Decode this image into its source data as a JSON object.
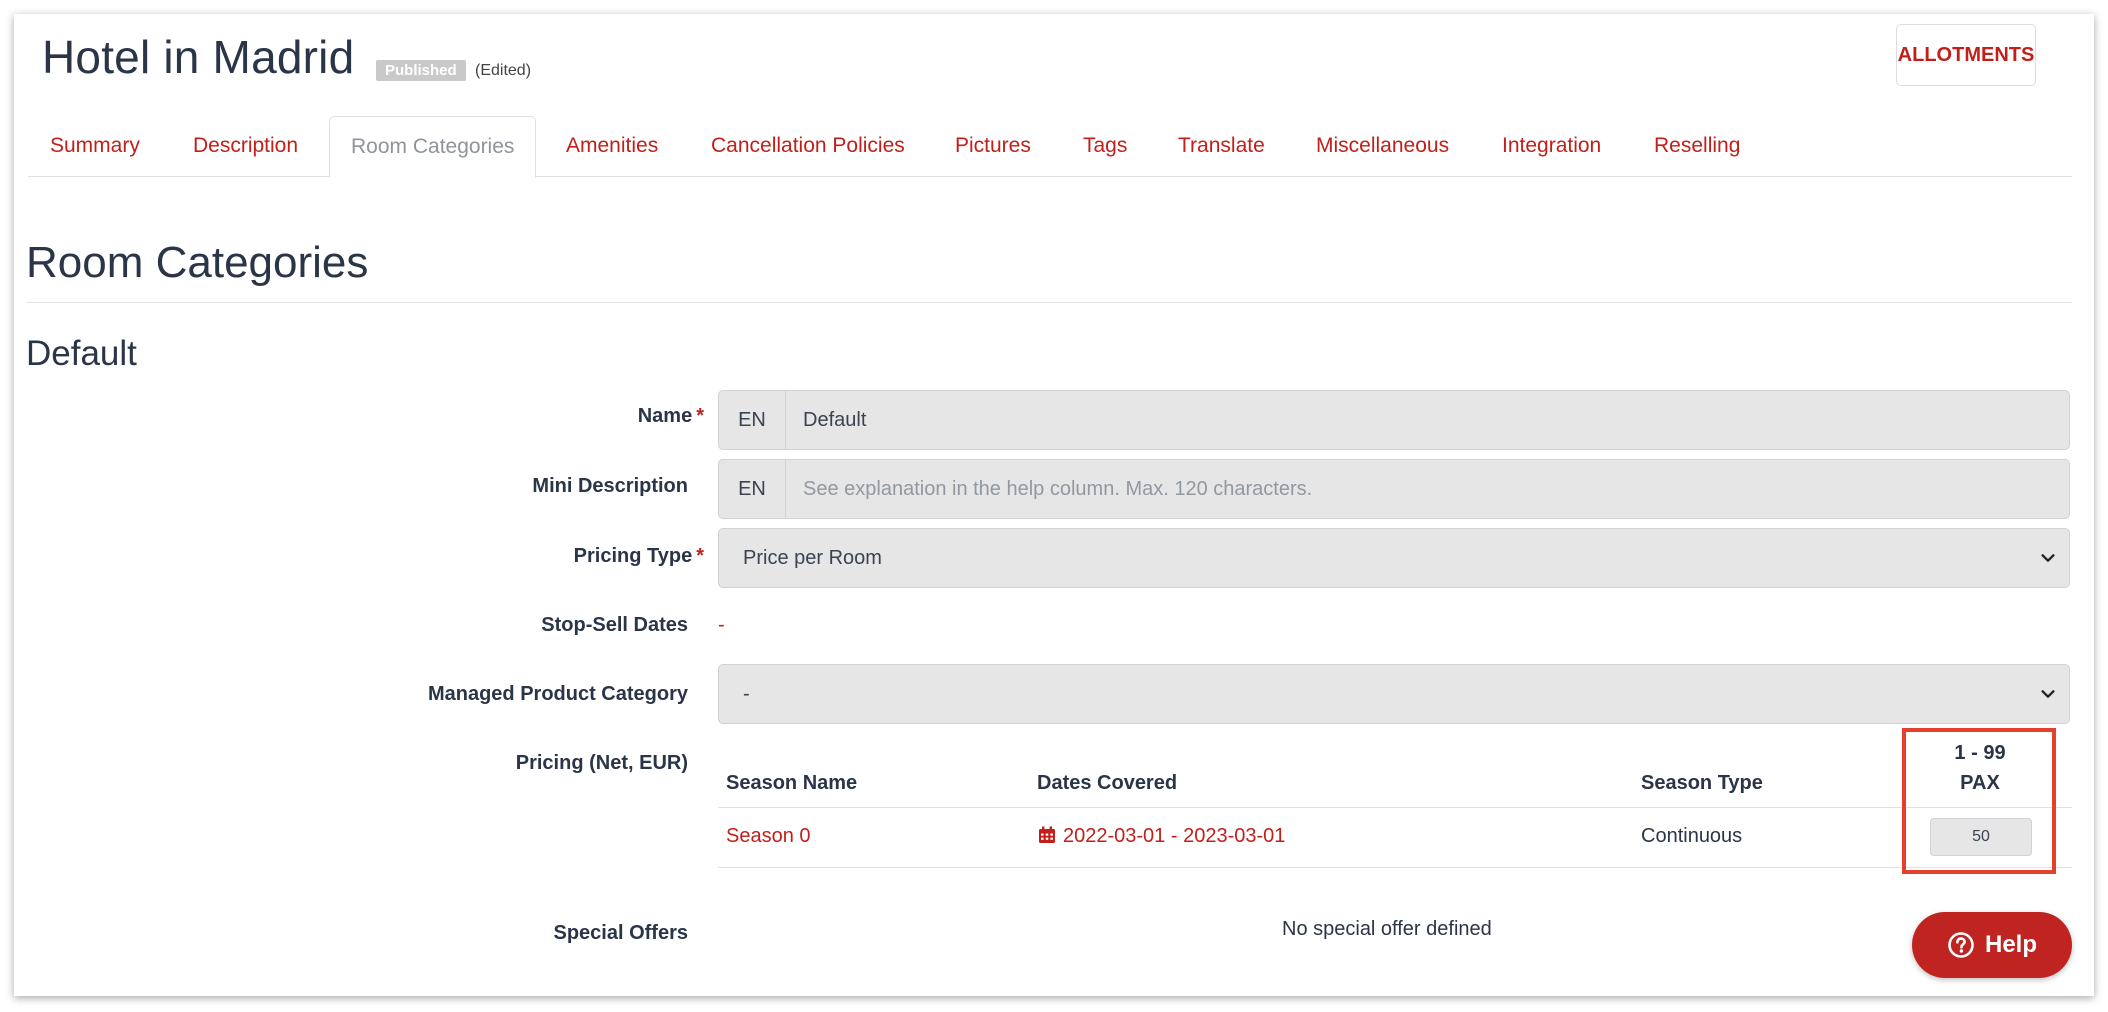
{
  "header": {
    "title": "Hotel in Madrid",
    "status_badge": "Published",
    "edited_label": "(Edited)",
    "allotments_button": "ALLOTMENTS"
  },
  "tabs": [
    {
      "label": "Summary"
    },
    {
      "label": "Description"
    },
    {
      "label": "Room Categories",
      "active": true
    },
    {
      "label": "Amenities"
    },
    {
      "label": "Cancellation Policies"
    },
    {
      "label": "Pictures"
    },
    {
      "label": "Tags"
    },
    {
      "label": "Translate"
    },
    {
      "label": "Miscellaneous"
    },
    {
      "label": "Integration"
    },
    {
      "label": "Reselling"
    }
  ],
  "section": {
    "heading": "Room Categories",
    "subheading": "Default"
  },
  "form": {
    "name": {
      "label": "Name",
      "required_mark": "*",
      "lang": "EN",
      "value": "Default"
    },
    "mini_description": {
      "label": "Mini Description",
      "lang": "EN",
      "placeholder": "See explanation in the help column. Max. 120 characters."
    },
    "pricing_type": {
      "label": "Pricing Type",
      "required_mark": "*",
      "value": "Price per Room"
    },
    "stop_sell": {
      "label": "Stop-Sell Dates",
      "value": "-"
    },
    "managed_category": {
      "label": "Managed Product Category",
      "value": "-"
    },
    "pricing": {
      "label": "Pricing (Net, EUR)",
      "columns": {
        "season_name": "Season Name",
        "dates_covered": "Dates Covered",
        "season_type": "Season Type",
        "pax_range": "1 - 99",
        "pax_unit": "PAX"
      },
      "rows": [
        {
          "season_name": "Season 0",
          "dates": "2022-03-01 - 2023-03-01",
          "season_type": "Continuous",
          "price": "50"
        }
      ]
    },
    "special_offers": {
      "label": "Special Offers",
      "value": "No special offer defined"
    }
  },
  "help_button": "Help",
  "colors": {
    "accent": "#c21f1a",
    "highlight": "#e4402b",
    "field_bg": "#e6e6e6"
  }
}
